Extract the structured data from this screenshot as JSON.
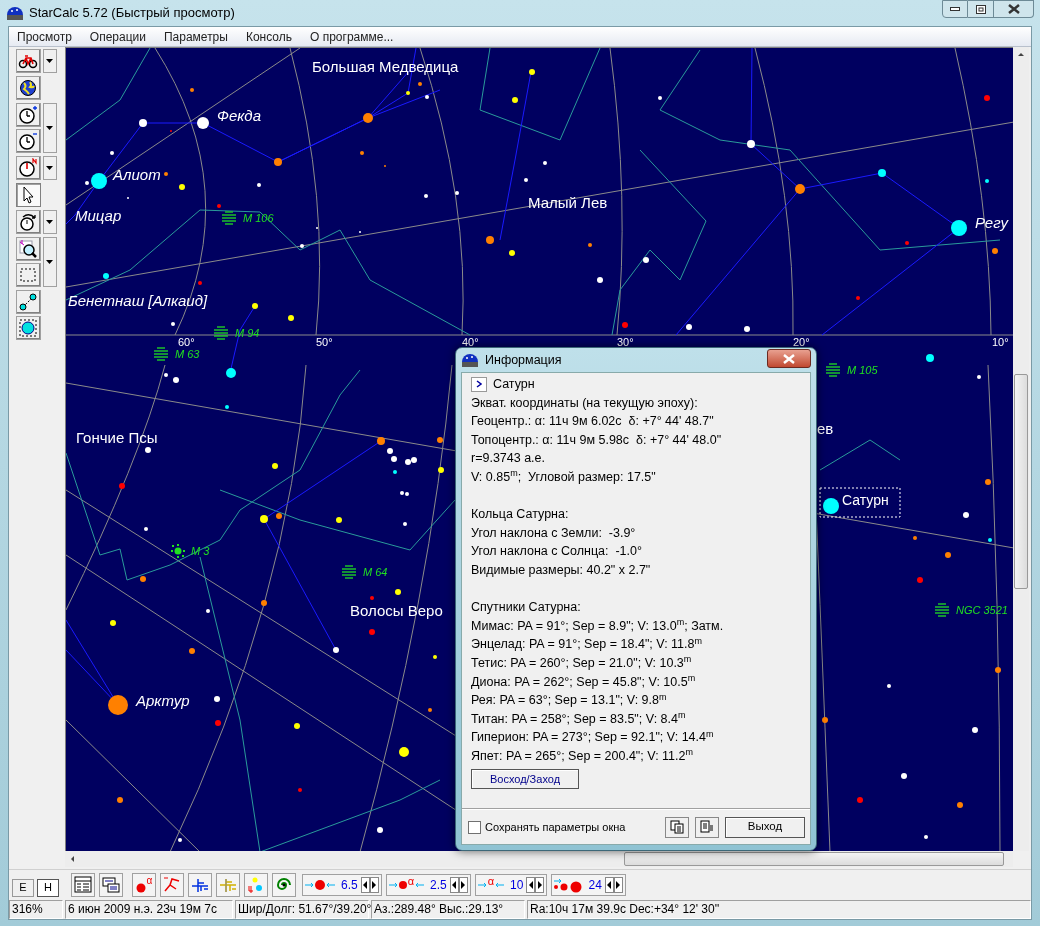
{
  "window": {
    "title": "StarCalc 5.72 (Быстрый просмотр)"
  },
  "menu": [
    "Просмотр",
    "Операции",
    "Параметры",
    "Консоль",
    "О программе..."
  ],
  "left_toolbar": [
    {
      "tools": [
        {
          "kind": "bicycle",
          "selected": false
        }
      ],
      "dropdown": true
    },
    {
      "tools": [
        {
          "kind": "globe",
          "selected": false
        }
      ],
      "dropdown": false
    },
    {
      "tools": [
        {
          "kind": "clock_plus",
          "selected": false
        },
        {
          "kind": "clock_minus",
          "selected": false
        }
      ],
      "dropdown": true
    },
    {
      "tools": [
        {
          "kind": "clock_north",
          "selected": false
        }
      ],
      "dropdown": true
    },
    {
      "tools": [
        {
          "kind": "pointer",
          "selected": true
        }
      ],
      "dropdown": false
    },
    {
      "tools": [
        {
          "kind": "rotate",
          "selected": false
        }
      ],
      "dropdown": true
    },
    {
      "tools": [
        {
          "kind": "zoom",
          "selected": false
        },
        {
          "kind": "select_rect",
          "selected": false
        }
      ],
      "dropdown": true
    },
    {
      "tools": [
        {
          "kind": "link",
          "selected": false
        },
        {
          "kind": "circle_select",
          "selected": false
        }
      ],
      "dropdown": false
    }
  ],
  "map_labels": [
    {
      "kind": "constellation",
      "text": "Большая Медведица"
    },
    {
      "kind": "star",
      "text": "Фекда"
    },
    {
      "kind": "star",
      "text": "Алиот"
    },
    {
      "kind": "star",
      "text": "Мицар"
    },
    {
      "kind": "galaxy",
      "text": "M 106"
    },
    {
      "kind": "constellation",
      "text": "Малый Лев"
    },
    {
      "kind": "star",
      "text": "Регу"
    },
    {
      "kind": "star",
      "text": "Бенетнаш [Алкаид]"
    },
    {
      "kind": "galaxy",
      "text": "M 94"
    },
    {
      "kind": "grid",
      "text": "60°"
    },
    {
      "kind": "grid",
      "text": "50°"
    },
    {
      "kind": "grid",
      "text": "40°"
    },
    {
      "kind": "grid",
      "text": "30°"
    },
    {
      "kind": "grid",
      "text": "20°"
    },
    {
      "kind": "grid",
      "text": "10°"
    },
    {
      "kind": "galaxy",
      "text": "M 63"
    },
    {
      "kind": "galaxy",
      "text": "M 105"
    },
    {
      "kind": "constellation",
      "text": "Гончие Псы"
    },
    {
      "kind": "constellation",
      "text": "ев"
    },
    {
      "kind": "planet",
      "text": "Сатурн"
    },
    {
      "kind": "cluster",
      "text": "M 3"
    },
    {
      "kind": "galaxy",
      "text": "M 64"
    },
    {
      "kind": "constellation",
      "text": "Волосы Веро"
    },
    {
      "kind": "galaxy",
      "text": "NGC 3521"
    },
    {
      "kind": "star",
      "text": "Арктур"
    }
  ],
  "info_dialog": {
    "title": "Информация",
    "object_name": "Сатурн",
    "sections": [
      {
        "lines": [
          "Экват. координаты (на текущую эпоху):",
          "Геоцентр.: α: 11ч 9м 6.02с  δ: +7° 44' 48.7\"",
          "Топоцентр.: α: 11ч 9м 5.98с  δ: +7° 44' 48.0\"",
          "r=9.3743 а.е.",
          "V: 0.85$^{m}$;  Угловой размер: 17.5\""
        ]
      },
      {
        "lines": [
          "Кольца Сатурна:",
          "Угол наклона с Земли:  -3.9°",
          "Угол наклона с Солнца:  -1.0°",
          "Видимые размеры: 40.2\" x 2.7\""
        ]
      },
      {
        "lines": [
          "Спутники Сатурна:",
          "Мимас: PA = 91°; Sep = 8.9\"; V: 13.0$^{m}$; Затм.",
          "Энцелад: PA = 91°; Sep = 18.4\"; V: 11.8$^{m}$",
          "Тетис: PA = 260°; Sep = 21.0\"; V: 10.3$^{m}$",
          "Диона: PA = 262°; Sep = 45.8\"; V: 10.5$^{m}$",
          "Рея: PA = 63°; Sep = 13.1\"; V: 9.8$^{m}$",
          "Титан: PA = 258°; Sep = 83.5\"; V: 8.4$^{m}$",
          "Гиперион: PA = 273°; Sep = 92.1\"; V: 14.4$^{m}$",
          "Япет: PA = 265°; Sep = 200.4\"; V: 11.2$^{m}$"
        ]
      }
    ],
    "rise_set_button": "Восход/Заход",
    "save_checkbox": {
      "label": "Сохранять параметры окна",
      "checked": false
    },
    "exit_button": "Выход"
  },
  "view_buttons": [
    {
      "label": "E",
      "selected": false
    },
    {
      "label": "H",
      "selected": true
    }
  ],
  "bottom_tools": [
    {
      "kind": "table"
    },
    {
      "kind": "list"
    },
    {
      "kind": "star_alpha",
      "symbol": "α"
    },
    {
      "kind": "red_lines"
    },
    {
      "kind": "blue_lines"
    },
    {
      "kind": "yellow_lines"
    },
    {
      "kind": "planets"
    },
    {
      "kind": "spiral"
    }
  ],
  "spinners": [
    {
      "kind": "star_size",
      "value": "6.5"
    },
    {
      "kind": "label_size",
      "symbol": "α",
      "value": "2.5"
    },
    {
      "kind": "alpha_size",
      "symbol": "α",
      "value": "10"
    },
    {
      "kind": "dots",
      "value": "24"
    }
  ],
  "status_bar": [
    "316%",
    "6 июн 2009 н.э. 23ч 19м 7с",
    "Шир/Долг: 51.67°/39.20°",
    "Аз.:289.48° Выс.:29.13°",
    "Ra:10ч 17м 39.9с Dec:+34° 12' 30''"
  ]
}
